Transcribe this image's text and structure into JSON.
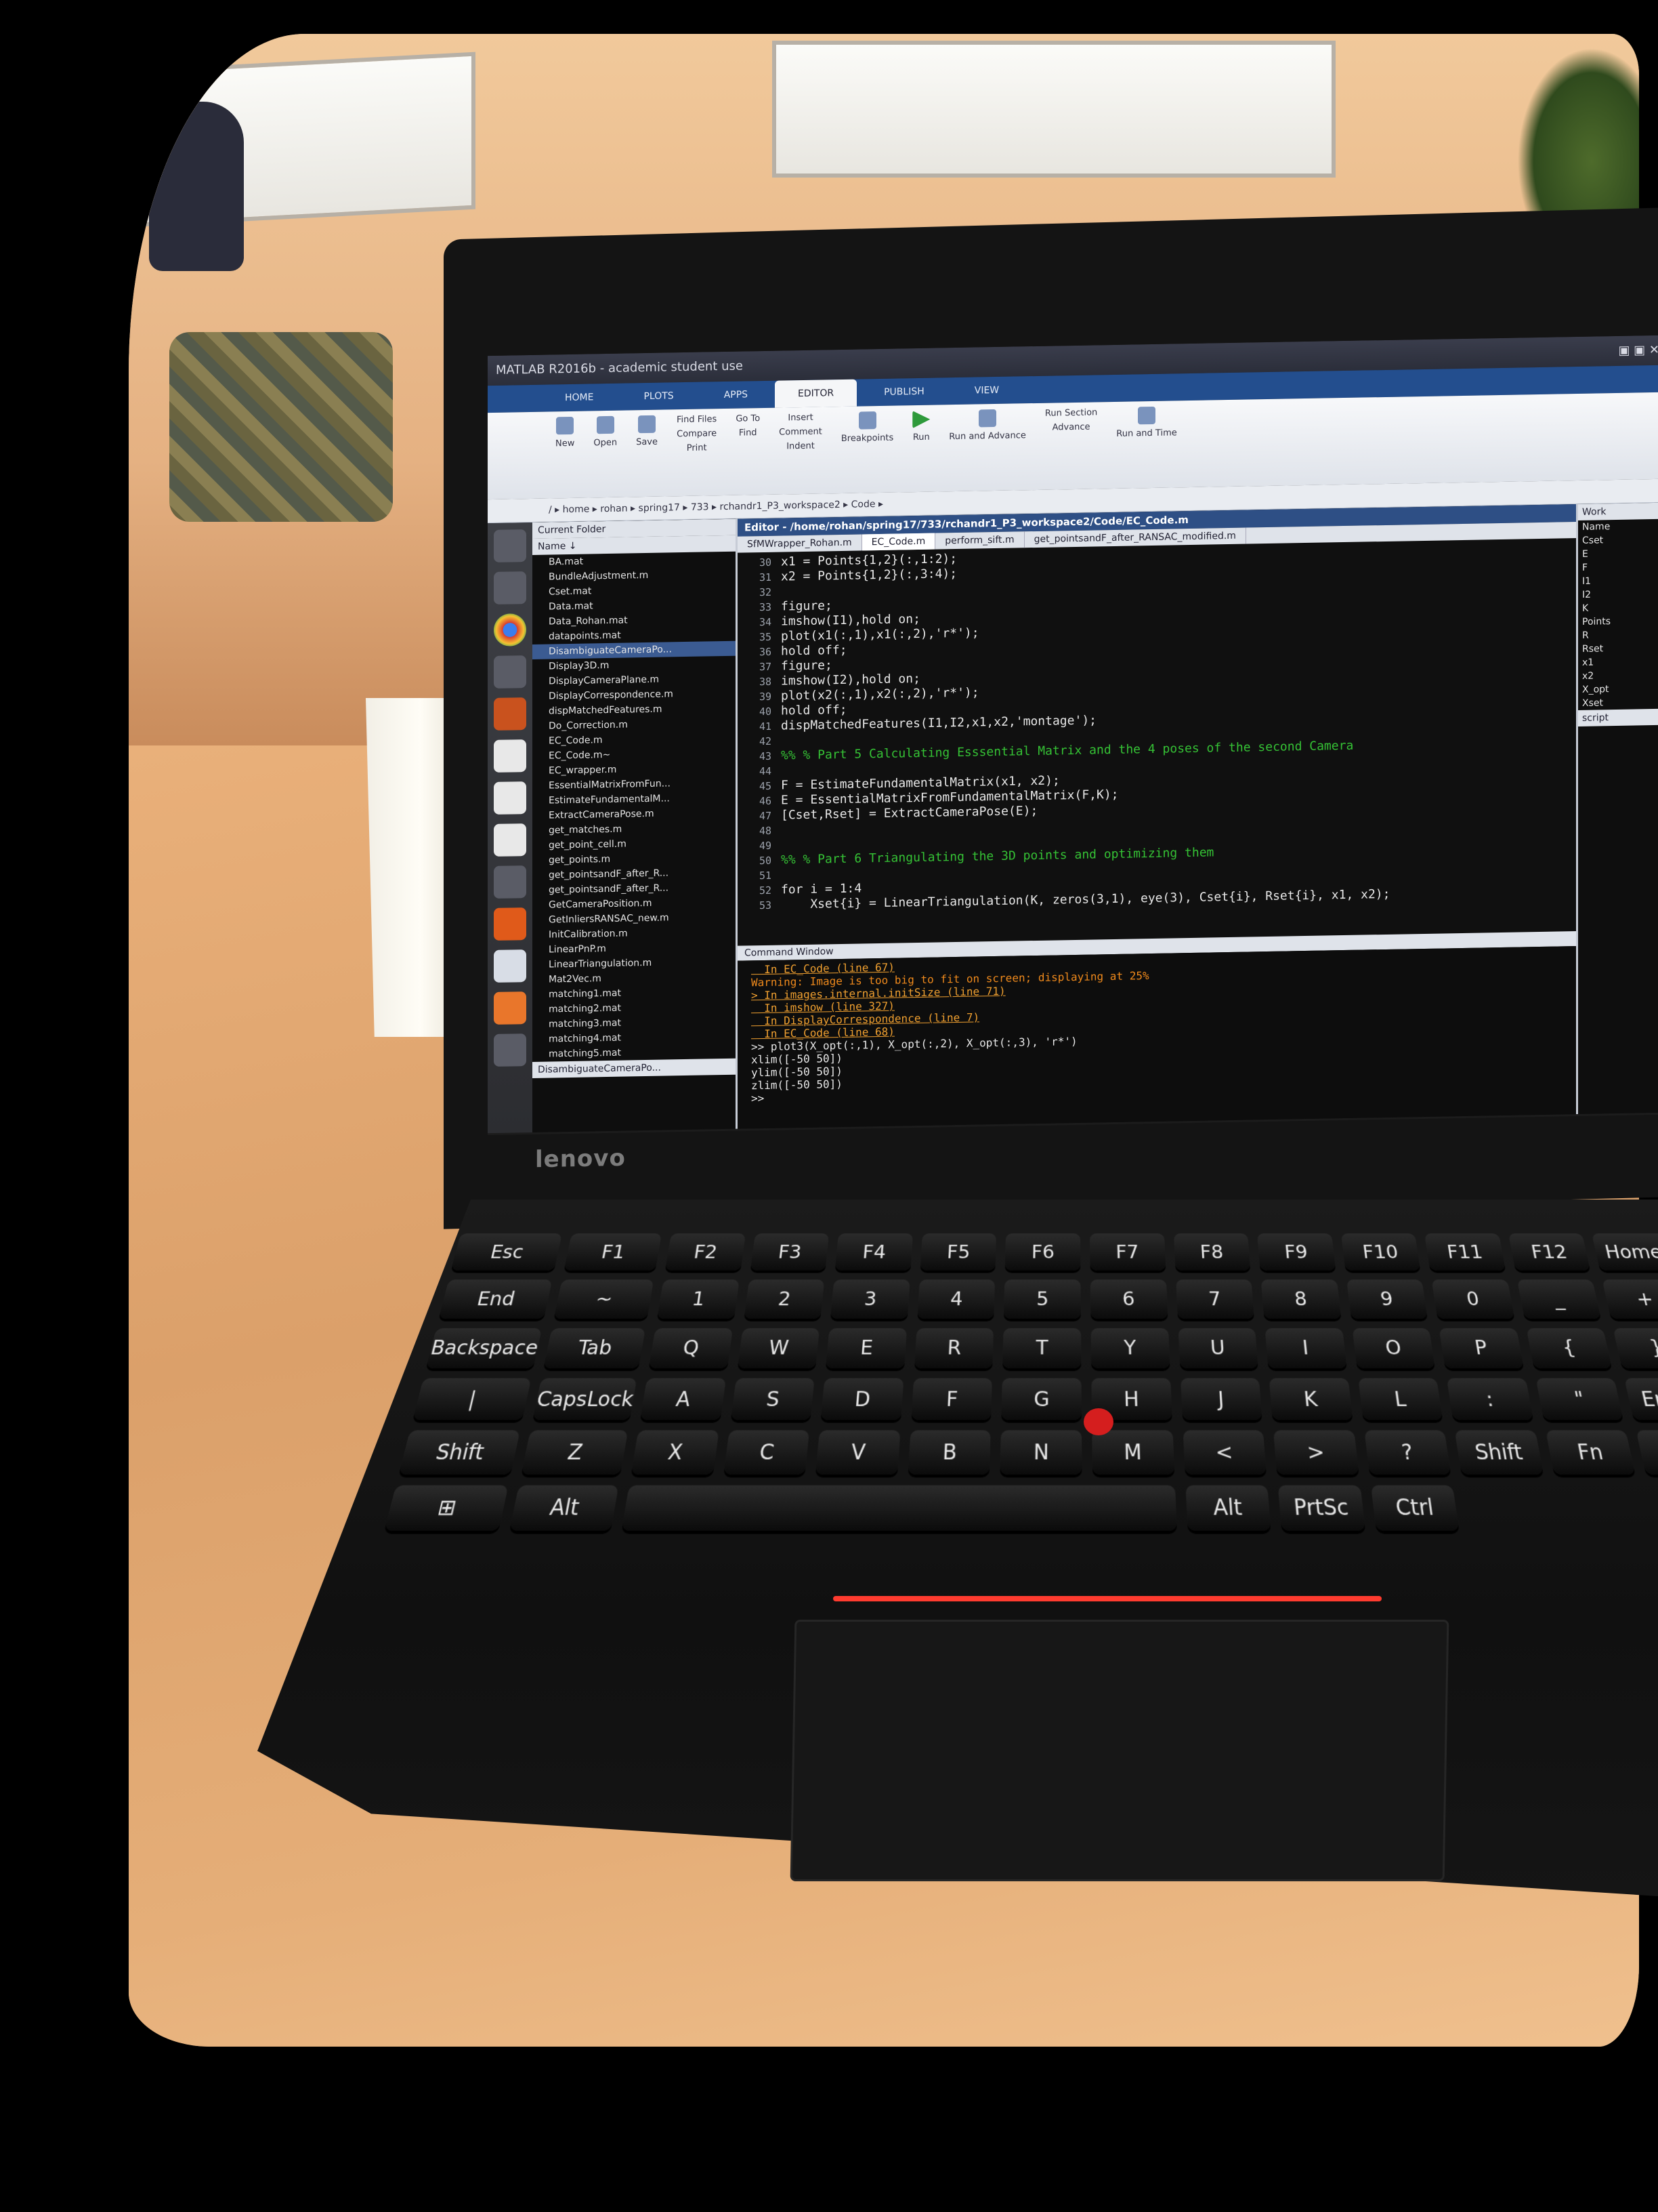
{
  "window": {
    "title": "MATLAB R2016b - academic student use"
  },
  "ribbon": {
    "tabs": [
      "HOME",
      "PLOTS",
      "APPS",
      "EDITOR",
      "PUBLISH",
      "VIEW"
    ],
    "active_tab": "EDITOR",
    "buttons": [
      "New",
      "Open",
      "Save",
      "Find Files",
      "Compare",
      "Print",
      "Go To",
      "Find",
      "Insert",
      "Comment",
      "Indent",
      "Breakpoints",
      "Run",
      "Run and Advance",
      "Run Section",
      "Advance",
      "Run and Time"
    ]
  },
  "address_bar": {
    "path": "/ ▸ home ▸ rohan ▸ spring17 ▸ 733 ▸ rchandr1_P3_workspace2 ▸ Code ▸"
  },
  "current_folder": {
    "header": "Current Folder",
    "column": "Name ↓",
    "items": [
      "BA.mat",
      "BundleAdjustment.m",
      "Cset.mat",
      "Data.mat",
      "Data_Rohan.mat",
      "datapoints.mat",
      "DisambiguateCameraPo...",
      "Display3D.m",
      "DisplayCameraPlane.m",
      "DisplayCorrespondence.m",
      "dispMatchedFeatures.m",
      "Do_Correction.m",
      "EC_Code.m",
      "EC_Code.m~",
      "EC_wrapper.m",
      "EssentialMatrixFromFun...",
      "EstimateFundamentalM...",
      "ExtractCameraPose.m",
      "get_matches.m",
      "get_point_cell.m",
      "get_points.m",
      "get_pointsandF_after_R...",
      "get_pointsandF_after_R...",
      "GetCameraPosition.m",
      "GetInliersRANSAC_new.m",
      "InitCalibration.m",
      "LinearPnP.m",
      "LinearTriangulation.m",
      "Mat2Vec.m",
      "matching1.mat",
      "matching2.mat",
      "matching3.mat",
      "matching4.mat",
      "matching5.mat"
    ],
    "selected": "DisambiguateCameraPo...",
    "footer": "DisambiguateCameraPo..."
  },
  "editor": {
    "header": "Editor - /home/rohan/spring17/733/rchandr1_P3_workspace2/Code/EC_Code.m",
    "tabs": [
      "SfMWrapper_Rohan.m",
      "EC_Code.m",
      "perform_sift.m",
      "get_pointsandF_after_RANSAC_modified.m"
    ],
    "active_tab": "EC_Code.m",
    "lines": [
      {
        "n": "30",
        "text": "x1 = Points{1,2}(:,1:2);"
      },
      {
        "n": "31",
        "text": "x2 = Points{1,2}(:,3:4);"
      },
      {
        "n": "32",
        "text": ""
      },
      {
        "n": "33",
        "text": "figure;"
      },
      {
        "n": "34",
        "text": "imshow(I1),hold on;"
      },
      {
        "n": "35",
        "text": "plot(x1(:,1),x1(:,2),'r*');"
      },
      {
        "n": "36",
        "text": "hold off;"
      },
      {
        "n": "37",
        "text": "figure;"
      },
      {
        "n": "38",
        "text": "imshow(I2),hold on;"
      },
      {
        "n": "39",
        "text": "plot(x2(:,1),x2(:,2),'r*');"
      },
      {
        "n": "40",
        "text": "hold off;"
      },
      {
        "n": "41",
        "text": "dispMatchedFeatures(I1,I2,x1,x2,'montage');"
      },
      {
        "n": "42",
        "text": ""
      },
      {
        "n": "43",
        "text": "%% % Part 5 Calculating Esssential Matrix and the 4 poses of the second Camera",
        "comment": true
      },
      {
        "n": "44",
        "text": ""
      },
      {
        "n": "45",
        "text": "F = EstimateFundamentalMatrix(x1, x2);"
      },
      {
        "n": "46",
        "text": "E = EssentialMatrixFromFundamentalMatrix(F,K);"
      },
      {
        "n": "47",
        "text": "[Cset,Rset] = ExtractCameraPose(E);"
      },
      {
        "n": "48",
        "text": ""
      },
      {
        "n": "49",
        "text": ""
      },
      {
        "n": "50",
        "text": "%% % Part 6 Triangulating the 3D points and optimizing them",
        "comment": true
      },
      {
        "n": "51",
        "text": ""
      },
      {
        "n": "52",
        "text": "for i = 1:4"
      },
      {
        "n": "53",
        "text": "    Xset{i} = LinearTriangulation(K, zeros(3,1), eye(3), Cset{i}, Rset{i}, x1, x2);"
      }
    ]
  },
  "command_window": {
    "header": "Command Window",
    "lines": [
      {
        "text": "  In EC_Code (line 67)",
        "kind": "link"
      },
      {
        "text": "Warning: Image is too big to fit on screen; displaying at 25%",
        "kind": "warn"
      },
      {
        "text": "> In images.internal.initSize (line 71)",
        "kind": "link"
      },
      {
        "text": "  In imshow (line 327)",
        "kind": "link"
      },
      {
        "text": "  In DisplayCorrespondence (line 7)",
        "kind": "link"
      },
      {
        "text": "  In EC_Code (line 68)",
        "kind": "link"
      },
      {
        "text": ">> plot3(X_opt(:,1), X_opt(:,2), X_opt(:,3), 'r*')",
        "kind": "plain"
      },
      {
        "text": "xlim([-50 50])",
        "kind": "plain"
      },
      {
        "text": "ylim([-50 50])",
        "kind": "plain"
      },
      {
        "text": "zlim([-50 50])",
        "kind": "plain"
      },
      {
        "text": ">>",
        "kind": "plain"
      }
    ]
  },
  "workspace": {
    "header": "Work",
    "items": [
      "Name",
      "Cset",
      "E",
      "F",
      "I1",
      "I2",
      "K",
      "Points",
      "R",
      "Rset",
      "x1",
      "x2",
      "X_opt",
      "Xset"
    ]
  },
  "status": {
    "script_label": "script"
  },
  "laptop": {
    "brand": "lenovo"
  },
  "keyboard": {
    "rows": [
      [
        "Esc",
        "F1",
        "F2",
        "F3",
        "F4",
        "F5",
        "F6",
        "F7",
        "F8",
        "F9",
        "F10",
        "F11",
        "F12",
        "Home",
        "End"
      ],
      [
        "~",
        "1",
        "2",
        "3",
        "4",
        "5",
        "6",
        "7",
        "8",
        "9",
        "0",
        "_",
        "+",
        "Backspace"
      ],
      [
        "Tab",
        "Q",
        "W",
        "E",
        "R",
        "T",
        "Y",
        "U",
        "I",
        "O",
        "P",
        "{",
        "}",
        "|"
      ],
      [
        "CapsLock",
        "A",
        "S",
        "D",
        "F",
        "G",
        "H",
        "J",
        "K",
        "L",
        ":",
        "\"",
        "Enter"
      ],
      [
        "Shift",
        "Z",
        "X",
        "C",
        "V",
        "B",
        "N",
        "M",
        "<",
        ">",
        "?",
        "Shift"
      ],
      [
        "Fn",
        "Ctrl",
        "⊞",
        "Alt",
        "",
        "Alt",
        "PrtSc",
        "Ctrl"
      ]
    ]
  },
  "colors": {
    "matlab_blue": "#234e8e",
    "trackpoint_red": "#d51e1e",
    "code_comment": "#35c235",
    "warning_orange": "#f08a1c"
  }
}
